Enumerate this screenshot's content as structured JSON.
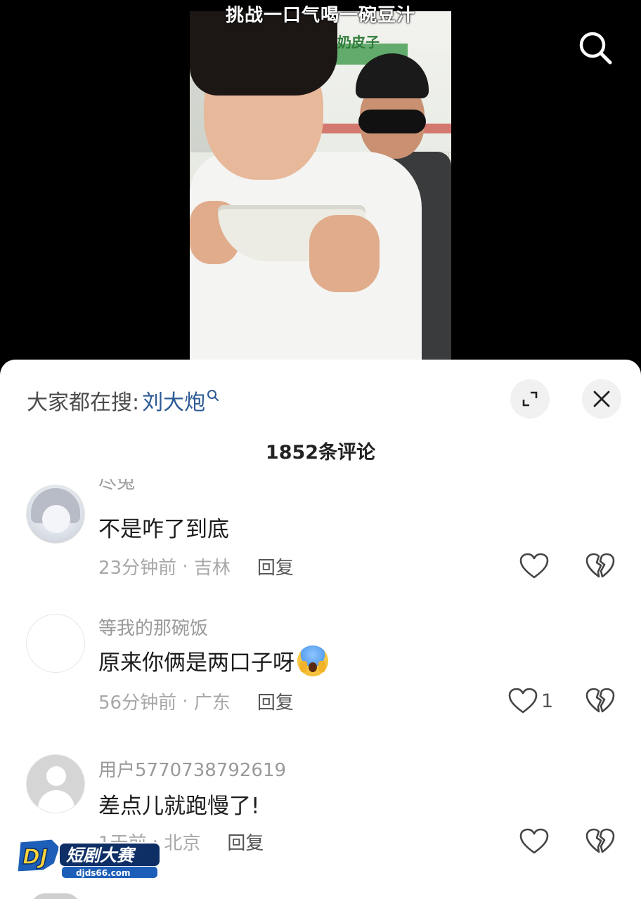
{
  "video": {
    "caption": "挑战一口气喝一碗豆汁",
    "sign_text": "奶皮子"
  },
  "sheet": {
    "trending_prefix": "大家都在搜:",
    "trending_keyword": "刘大炮",
    "comment_count": "1852条评论"
  },
  "comments": [
    {
      "username": "尽兔",
      "text": "不是咋了到底",
      "time": "23分钟前",
      "location": "吉林",
      "reply_label": "回复",
      "likes": ""
    },
    {
      "username": "等我的那碗饭",
      "text": "原来你俩是两口子呀",
      "emoji": "face-screaming-in-fear",
      "time": "56分钟前",
      "location": "广东",
      "reply_label": "回复",
      "likes": "1"
    },
    {
      "username": "用户5770738792619",
      "text": "差点儿就跑慢了!",
      "time": "1天前",
      "location": "北京",
      "reply_label": "回复",
      "likes": ""
    }
  ],
  "watermark": {
    "brand": "短剧大赛",
    "site": "djds66.com",
    "logo": "DJ"
  },
  "icons": [
    "search-icon",
    "expand-icon",
    "close-icon",
    "heart-icon",
    "broken-heart-icon"
  ]
}
